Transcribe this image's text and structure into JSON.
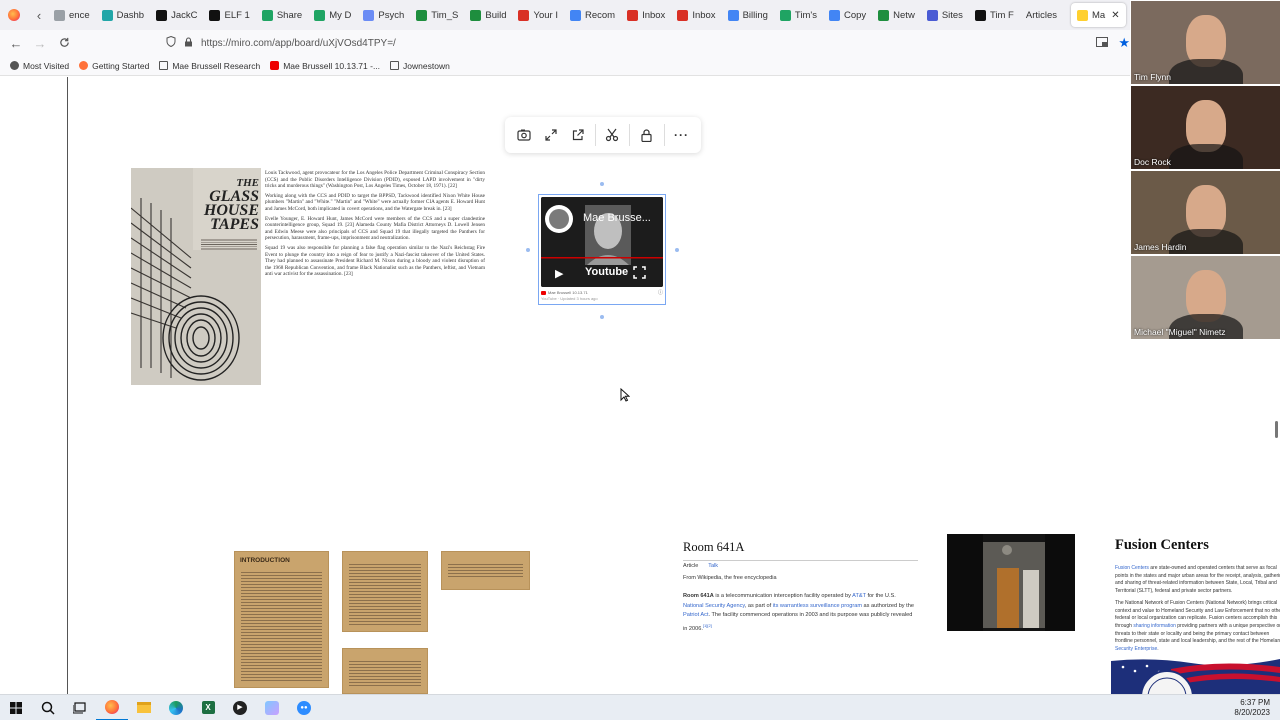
{
  "browser": {
    "tabs": [
      {
        "label": "ence",
        "icon": "tab-page-icon",
        "color": "#9aa0a6"
      },
      {
        "label": "Dashb",
        "icon": "puzzle-icon",
        "color": "#22a6a8"
      },
      {
        "label": "JackC",
        "icon": "co-icon",
        "color": "#111111"
      },
      {
        "label": "ELF 1",
        "icon": "tv-icon",
        "color": "#111111"
      },
      {
        "label": "Share",
        "icon": "drive-icon",
        "color": "#1fa463"
      },
      {
        "label": "My D",
        "icon": "drive-icon",
        "color": "#1fa463"
      },
      {
        "label": "Psych",
        "icon": "bookmark-p-icon",
        "color": "#6b8cf5"
      },
      {
        "label": "Tim_S",
        "icon": "sheets-icon",
        "color": "#1e8e3e"
      },
      {
        "label": "Build",
        "icon": "sheets-icon",
        "color": "#1e8e3e"
      },
      {
        "label": "Your I",
        "icon": "gmail-icon",
        "color": "#d93025"
      },
      {
        "label": "Recom",
        "icon": "ads-icon",
        "color": "#4285f4"
      },
      {
        "label": "Inbox",
        "icon": "gmail-icon",
        "color": "#d93025"
      },
      {
        "label": "Inbox",
        "icon": "gmail-icon",
        "color": "#d93025"
      },
      {
        "label": "Billing",
        "icon": "ads-icon",
        "color": "#4285f4"
      },
      {
        "label": "Tim's",
        "icon": "drive-icon",
        "color": "#1fa463"
      },
      {
        "label": "Copy",
        "icon": "docs-icon",
        "color": "#4285f4"
      },
      {
        "label": "Netw",
        "icon": "sheets-icon",
        "color": "#1e8e3e"
      },
      {
        "label": "Sites",
        "icon": "sites-icon",
        "color": "#4a5bd4"
      },
      {
        "label": "Tim F",
        "icon": "w-icon",
        "color": "#111111"
      },
      {
        "label": "Articles",
        "icon": "",
        "color": "#ffffff"
      },
      {
        "label": "Ma",
        "icon": "miro-icon",
        "color": "#ffd02f",
        "active": true
      }
    ],
    "url": "https://miro.com/app/board/uXjVOsd4TPY=/",
    "bookmarks": [
      {
        "label": "Most Visited",
        "icon": "gear-icon"
      },
      {
        "label": "Getting Started",
        "icon": "firefox-icon"
      },
      {
        "label": "Mae Brussell Research",
        "icon": "folder-icon"
      },
      {
        "label": "Mae Brussell 10.13.71 -...",
        "icon": "youtube-icon"
      },
      {
        "label": "Jownestown",
        "icon": "folder-icon"
      }
    ]
  },
  "board": {
    "book_cover": {
      "line1": "THE",
      "line2": "GLASS",
      "line3": "HOUSE",
      "line4": "TAPES"
    },
    "book_paragraphs": [
      "Louis Tackwood, agent provocateur for the Los Angeles Police Department Criminal Conspiracy Section (CCS) and the Public Disorders Intelligence Division (PDID), exposed LAPD involvement in \"dirty tricks and murderous things\" (Washington Post, Los Angeles Times, October 18, 1971). [22]",
      "Working along with the CCS and PDID to target the BPPSD, Tackwood identified Nixon White House plumbers \"Martin\" and \"White.\" \"Martin\" and \"White\" were actually former CIA agents E. Howard Hunt and James McCord, both implicated in covert operations, and the Watergate break in. [23]",
      "Evelle Younger, E. Howard Hunt, James McCord were members of the CCS and a super clandestine counterintelligence group, Squad 19. [23] Alameda County Mafia District Attorneys D. Lowell Jensen and Edwin Meese were also principals of CCS and Squad 19 that illegally targeted the Panthers for persecution, harassment, frame-ups, imprisonment and neutralization.",
      "Squad 19 was also responsible for planning a false flag operation similar to the Nazi's Reichstag Fire Event to plunge the country into a reign of fear to justify a Nazi-fascist takeover of the United States. They had planned to assassinate President Richard M. Nixon during a bloody and violent disruption of the 1968 Republican Convention, and frame Black Nationalist such as the Panthers, leftist, and Vietnam anti war activist for the assassination. [23]"
    ],
    "youtube": {
      "title": "Mae Brusse...",
      "brand": "Youtube",
      "footer_title": "Mae Brussell 10.13.71",
      "footer_meta": "YouTube · Updated 3 hours ago"
    },
    "scan_heading": "INTRODUCTION",
    "wiki": {
      "title": "Room 641A",
      "tab_article": "Article",
      "tab_talk": "Talk",
      "from": "From Wikipedia, the free encyclopedia",
      "bold": "Room 641A",
      "t1": " is a telecommunication interception facility operated by ",
      "l1": "AT&T",
      "t2": " for the U.S. ",
      "l2": "National Security Agency",
      "t3": ", as part of ",
      "l3": "its warrantless surveillance program",
      "t4": " as authorized by the ",
      "l4": "Patriot Act",
      "t5": ". The facility commenced operations in 2003 and its purpose was publicly revealed in 2006.",
      "ref": "[1][2]"
    },
    "fusion": {
      "title": "Fusion Centers",
      "l1": "Fusion Centers",
      "t1": " are state-owned and operated centers that serve as focal points in the states and major urban areas for the receipt, analysis, gathering and sharing of threat-related information between State, Local, Tribal and Territorial (SLTT), federal and private sector partners.",
      "t2": "The National Network of Fusion Centers (National Network) brings critical context and value to Homeland Security and Law Enforcement that no other federal or local organization can replicate. Fusion centers accomplish this through ",
      "l2": "sharing information",
      "t3": " providing partners with a unique perspective on threats to their state or locality and being the primary contact between frontline personnel, state and local leadership, and the rest of the Homeland ",
      "l3": "Security Enterprise",
      "t4": "."
    }
  },
  "participants": [
    {
      "name": "Tim Flynn",
      "bg": "#7b6a5e"
    },
    {
      "name": "Doc Rock",
      "bg": "#3c2a22"
    },
    {
      "name": "James Hardin",
      "bg": "#6b5a48"
    },
    {
      "name": "Michael \"Miguel\" Nimetz",
      "bg": "#a59b90"
    }
  ],
  "taskbar": {
    "time": "6:37 PM",
    "date": "8/20/2023"
  }
}
